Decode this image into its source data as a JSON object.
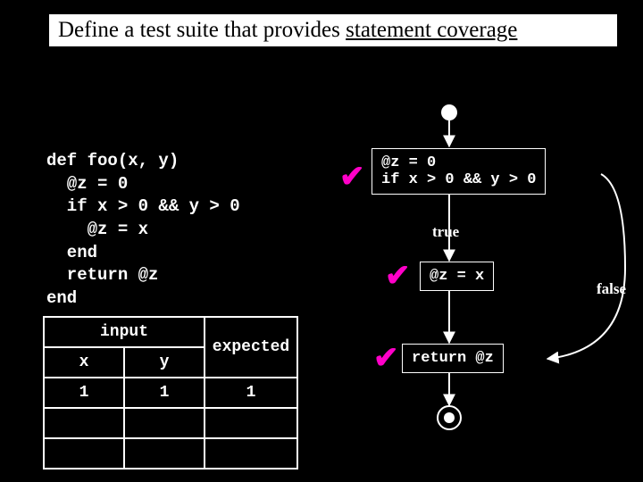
{
  "title_prefix": "Define a test suite that provides ",
  "title_underlined": "statement coverage",
  "code": "def foo(x, y)\n  @z = 0\n  if x > 0 && y > 0\n    @z = x\n  end\n  return @z\nend",
  "table": {
    "input_header": "input",
    "expected_header": "expected",
    "x_header": "x",
    "y_header": "y",
    "rows": [
      {
        "x": "1",
        "y": "1",
        "expected": "1"
      },
      {
        "x": "",
        "y": "",
        "expected": ""
      },
      {
        "x": "",
        "y": "",
        "expected": ""
      }
    ]
  },
  "flow": {
    "node1": "@z = 0\nif x > 0 && y > 0",
    "node2": "@z = x",
    "node3": "return @z",
    "label_true": "true",
    "label_false": "false"
  },
  "check_glyph": "✔"
}
